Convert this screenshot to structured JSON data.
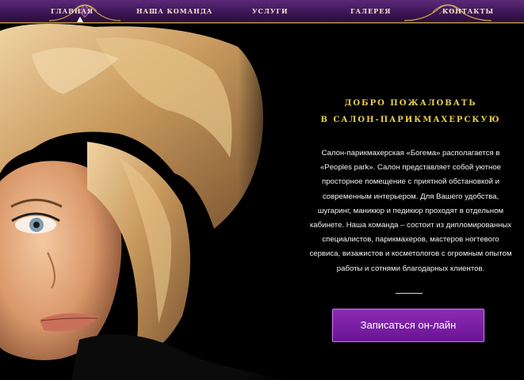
{
  "nav": {
    "items": [
      {
        "label": "главная",
        "active": true
      },
      {
        "label": "наша команда"
      },
      {
        "label": "услуги"
      },
      {
        "label": "галерея"
      },
      {
        "label": "контакты"
      }
    ]
  },
  "hero": {
    "title_line1": "ДОБРО ПОЖАЛОВАТЬ",
    "title_line2": "В САЛОН-ПАРИКМАХЕРСКУЮ",
    "description": "Салон-парикмахерская «Богема» располагается в «Peoples park». Салон представляет собой уютное просторное помещение с приятной обстановкой и современным интерьером. Для Вашего удобства, шугаринг, маникюр и педикюр проходят в отдельном кабинете. Наша команда – состоит из дипломированных специалистов, парикмахеров, мастеров ногтевого сервиса, визажистов и косметологов с огромным опытом работы и сотнями благодарных клиентов.",
    "cta_label": "Записаться он-лайн",
    "portrait_icon": "woman-portrait-photo"
  },
  "colors": {
    "nav_bg": "#3e1656",
    "gold": "#e8cf4a",
    "cta": "#7a1fa6",
    "background": "#000000"
  }
}
